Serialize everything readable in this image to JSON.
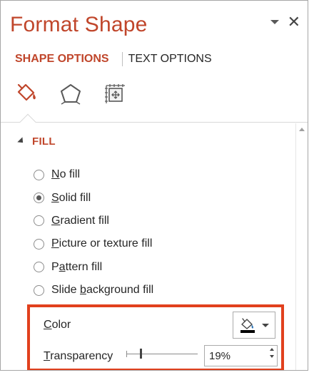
{
  "pane": {
    "title": "Format Shape",
    "icons": {
      "options_menu": "chevron-down-icon",
      "close": "close-icon",
      "close_glyph": "✕"
    }
  },
  "tabs": [
    {
      "label": "SHAPE OPTIONS",
      "active": true
    },
    {
      "label": "TEXT OPTIONS",
      "active": false
    }
  ],
  "category_icons": [
    {
      "name": "fill-line-icon",
      "active": true
    },
    {
      "name": "effects-pentagon-icon",
      "active": false
    },
    {
      "name": "size-properties-icon",
      "active": false
    }
  ],
  "fill_section": {
    "label": "FILL",
    "expanded": true,
    "options": [
      {
        "pre": "",
        "key": "N",
        "post": "o fill",
        "selected": false
      },
      {
        "pre": "",
        "key": "S",
        "post": "olid fill",
        "selected": true
      },
      {
        "pre": "",
        "key": "G",
        "post": "radient fill",
        "selected": false
      },
      {
        "pre": "",
        "key": "P",
        "post": "icture or texture fill",
        "selected": false
      },
      {
        "pre": "P",
        "key": "a",
        "post": "ttern fill",
        "selected": false
      },
      {
        "pre": "Slide ",
        "key": "b",
        "post": "ackground fill",
        "selected": false
      }
    ]
  },
  "color": {
    "label_key": "C",
    "label_rest": "olor",
    "swatch_color": "#000000",
    "icon": "paint-bucket-icon"
  },
  "transparency": {
    "label_key": "T",
    "label_rest": "ransparency",
    "value": "19%",
    "level": 0.19
  },
  "colors": {
    "accent": "#c0462b",
    "highlight_box": "#e1401d"
  }
}
